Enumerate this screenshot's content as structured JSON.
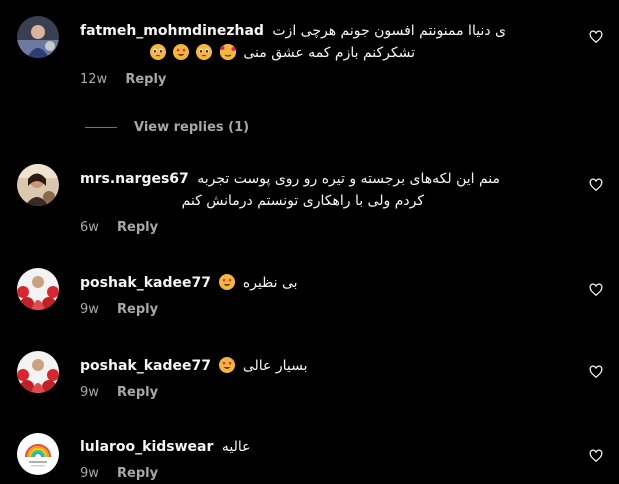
{
  "comments": [
    {
      "username": "fatmeh_mohmdinezhad",
      "text_line1": "ی دنیاا ممنونتم افسون جونم هرچی ازت",
      "text_line2": "تشکرکنم بازم کمه عشق منی",
      "emojis": [
        "face-with-hearts",
        "pleading-face",
        "smiling-face-with-heart-eyes",
        "pleading-face"
      ],
      "time": "12w",
      "reply_label": "Reply"
    },
    {
      "username": "mrs.narges67",
      "text_line1": "منم این لکه‌های برجسته و تیره رو روی پوست تجربه",
      "text_line2": "کردم ولی با راهکاری تونستم درمانش کنم",
      "time": "6w",
      "reply_label": "Reply"
    },
    {
      "username": "poshak_kadee77",
      "text_line1": "بی نظیره",
      "emojis": [
        "smiling-face-with-heart-eyes"
      ],
      "time": "9w",
      "reply_label": "Reply"
    },
    {
      "username": "poshak_kadee77",
      "text_line1": "بسیار عالی",
      "emojis": [
        "smiling-face-with-heart-eyes"
      ],
      "time": "9w",
      "reply_label": "Reply"
    },
    {
      "username": "lularoo_kidswear",
      "text_line1": "عالیه",
      "time": "9w",
      "reply_label": "Reply"
    }
  ],
  "view_replies_label": "View replies (1)",
  "colors": {
    "background": "#000000",
    "text_primary": "#f5f5f5",
    "text_secondary": "#a8a8a8"
  }
}
